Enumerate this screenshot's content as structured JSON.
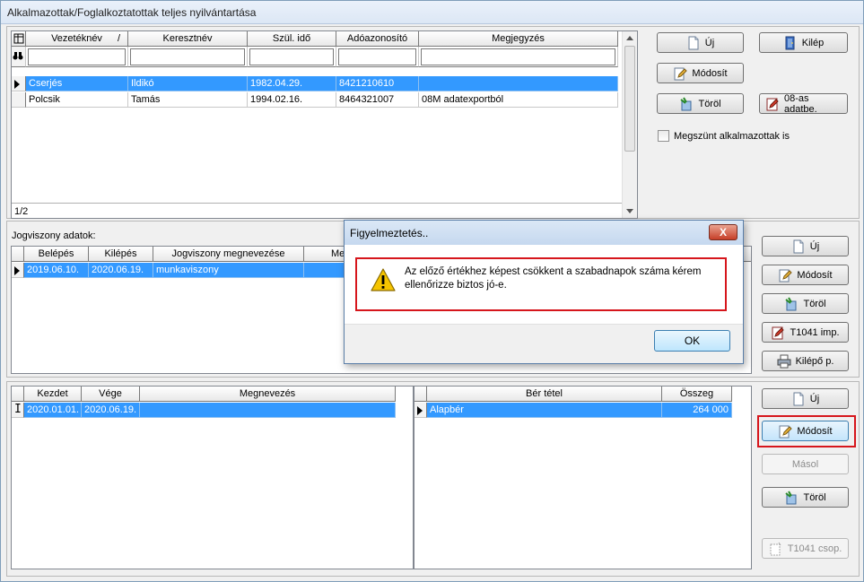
{
  "window": {
    "title": "Alkalmazottak/Foglalkoztatottak teljes nyilvántartása"
  },
  "employees": {
    "columns": [
      "Vezetéknév",
      "Keresztnév",
      "Szül. idő",
      "Adóazonosító",
      "Megjegyzés"
    ],
    "sort_mark": "/",
    "rows": [
      {
        "vezeteknev": "Cserjés",
        "keresztnev": "Ildikó",
        "szul": "1982.04.29.",
        "ado": "8421210610",
        "megj": ""
      },
      {
        "vezeteknev": "Polcsik",
        "keresztnev": "Tamás",
        "szul": "1994.02.16.",
        "ado": "8464321007",
        "megj": "08M adatexportból"
      }
    ],
    "status": "1/2",
    "buttons": {
      "new": "Új",
      "exit": "Kilép",
      "modify": "Módosít",
      "delete": "Töröl",
      "import08": "08-as adatbe."
    },
    "checkbox_label": "Megszünt alkalmazottak is"
  },
  "jogviszony": {
    "label": "Jogviszony adatok:",
    "columns": [
      "Belépés",
      "Kilépés",
      "Jogviszony megnevezése",
      "Me"
    ],
    "rows": [
      {
        "belepes": "2019.06.10.",
        "kilepes": "2020.06.19.",
        "megnev": "munkaviszony"
      }
    ],
    "buttons": {
      "new": "Új",
      "modify": "Módosít",
      "delete": "Töröl",
      "t1041": "T1041 imp.",
      "kilepo": "Kilépő p."
    }
  },
  "periods": {
    "columns": [
      "Kezdet",
      "Vége",
      "Megnevezés"
    ],
    "rows": [
      {
        "kezdet": "2020.01.01.",
        "vege": "2020.06.19.",
        "megnev": ""
      }
    ]
  },
  "wages": {
    "columns": [
      "Bér tétel",
      "Összeg"
    ],
    "rows": [
      {
        "tetel": "Alapbér",
        "osszeg": "264 000"
      }
    ],
    "buttons": {
      "new": "Új",
      "modify": "Módosít",
      "copy": "Másol",
      "delete": "Töröl",
      "t1041csop": "T1041 csop."
    }
  },
  "dialog": {
    "title": "Figyelmeztetés..",
    "close": "X",
    "message": "Az előző értékhez képest csökkent a szabadnapok száma kérem ellenőrizze biztos jó-e.",
    "ok": "OK"
  },
  "colors": {
    "selection": "#3399ff",
    "highlight_box": "#d6161c",
    "warning": "#f5c400"
  }
}
